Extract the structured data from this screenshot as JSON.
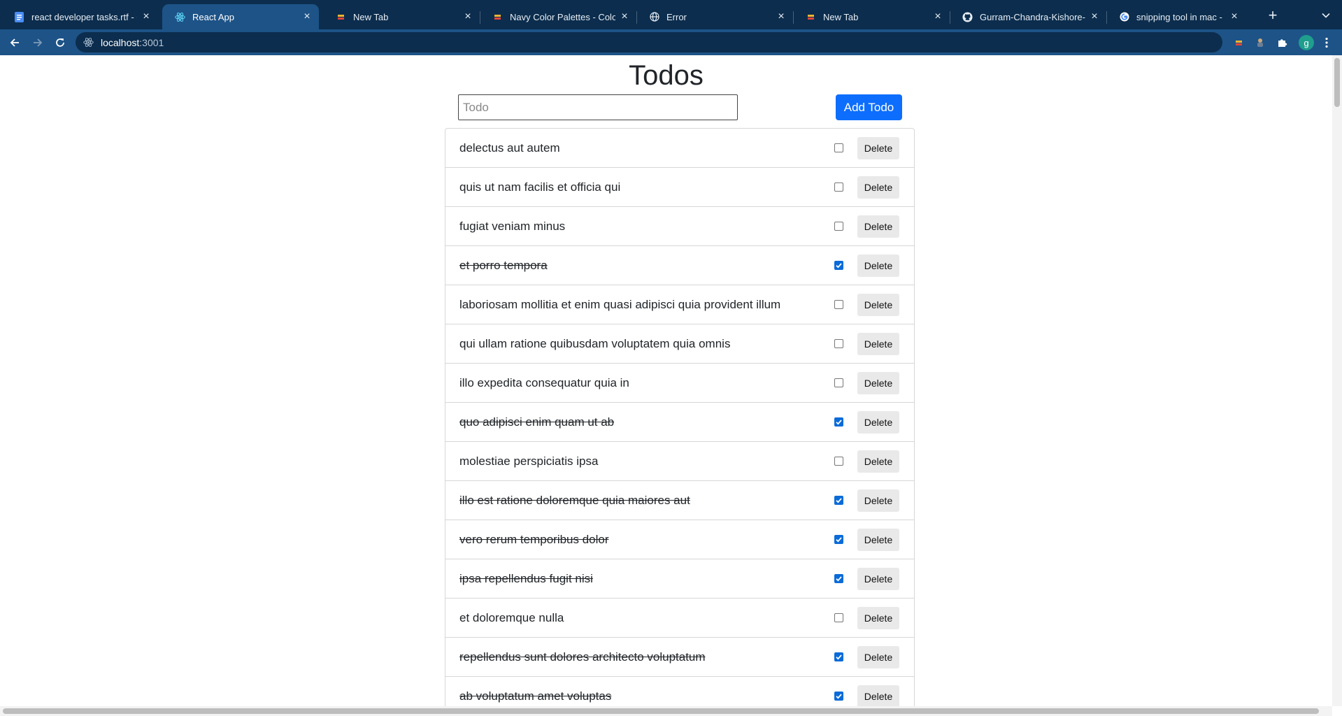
{
  "browser": {
    "tabs": [
      {
        "title": "react developer tasks.rtf - G",
        "icon": "docs-icon",
        "active": false
      },
      {
        "title": "React App",
        "icon": "react-icon",
        "active": true
      },
      {
        "title": "New Tab",
        "icon": "new-tab-icon",
        "active": false
      },
      {
        "title": "Navy Color Palettes - Color",
        "icon": "palette-site-icon",
        "active": false
      },
      {
        "title": "Error",
        "icon": "globe-icon",
        "active": false
      },
      {
        "title": "New Tab",
        "icon": "new-tab-icon",
        "active": false
      },
      {
        "title": "Gurram-Chandra-Kishore-R",
        "icon": "github-icon",
        "active": false
      },
      {
        "title": "snipping tool in mac - Goog",
        "icon": "google-icon",
        "active": false
      }
    ],
    "address": {
      "host": "localhost",
      "port": ":3001"
    },
    "profile_initial": "g",
    "colors": {
      "tabbar": "#0c2d4d",
      "toolbar": "#1d5387"
    }
  },
  "page": {
    "title": "Todos",
    "input_placeholder": "Todo",
    "input_value": "",
    "add_label": "Add Todo",
    "accent": "#0d6efd"
  },
  "todos": [
    {
      "text": "delectus aut autem",
      "completed": false
    },
    {
      "text": "quis ut nam facilis et officia qui",
      "completed": false
    },
    {
      "text": "fugiat veniam minus",
      "completed": false
    },
    {
      "text": "et porro tempora",
      "completed": true
    },
    {
      "text": "laboriosam mollitia et enim quasi adipisci quia provident illum",
      "completed": false
    },
    {
      "text": "qui ullam ratione quibusdam voluptatem quia omnis",
      "completed": false
    },
    {
      "text": "illo expedita consequatur quia in",
      "completed": false
    },
    {
      "text": "quo adipisci enim quam ut ab",
      "completed": true
    },
    {
      "text": "molestiae perspiciatis ipsa",
      "completed": false
    },
    {
      "text": "illo est ratione doloremque quia maiores aut",
      "completed": true
    },
    {
      "text": "vero rerum temporibus dolor",
      "completed": true
    },
    {
      "text": "ipsa repellendus fugit nisi",
      "completed": true
    },
    {
      "text": "et doloremque nulla",
      "completed": false
    },
    {
      "text": "repellendus sunt dolores architecto voluptatum",
      "completed": true
    },
    {
      "text": "ab voluptatum amet voluptas",
      "completed": true
    }
  ],
  "delete_label": "Delete"
}
